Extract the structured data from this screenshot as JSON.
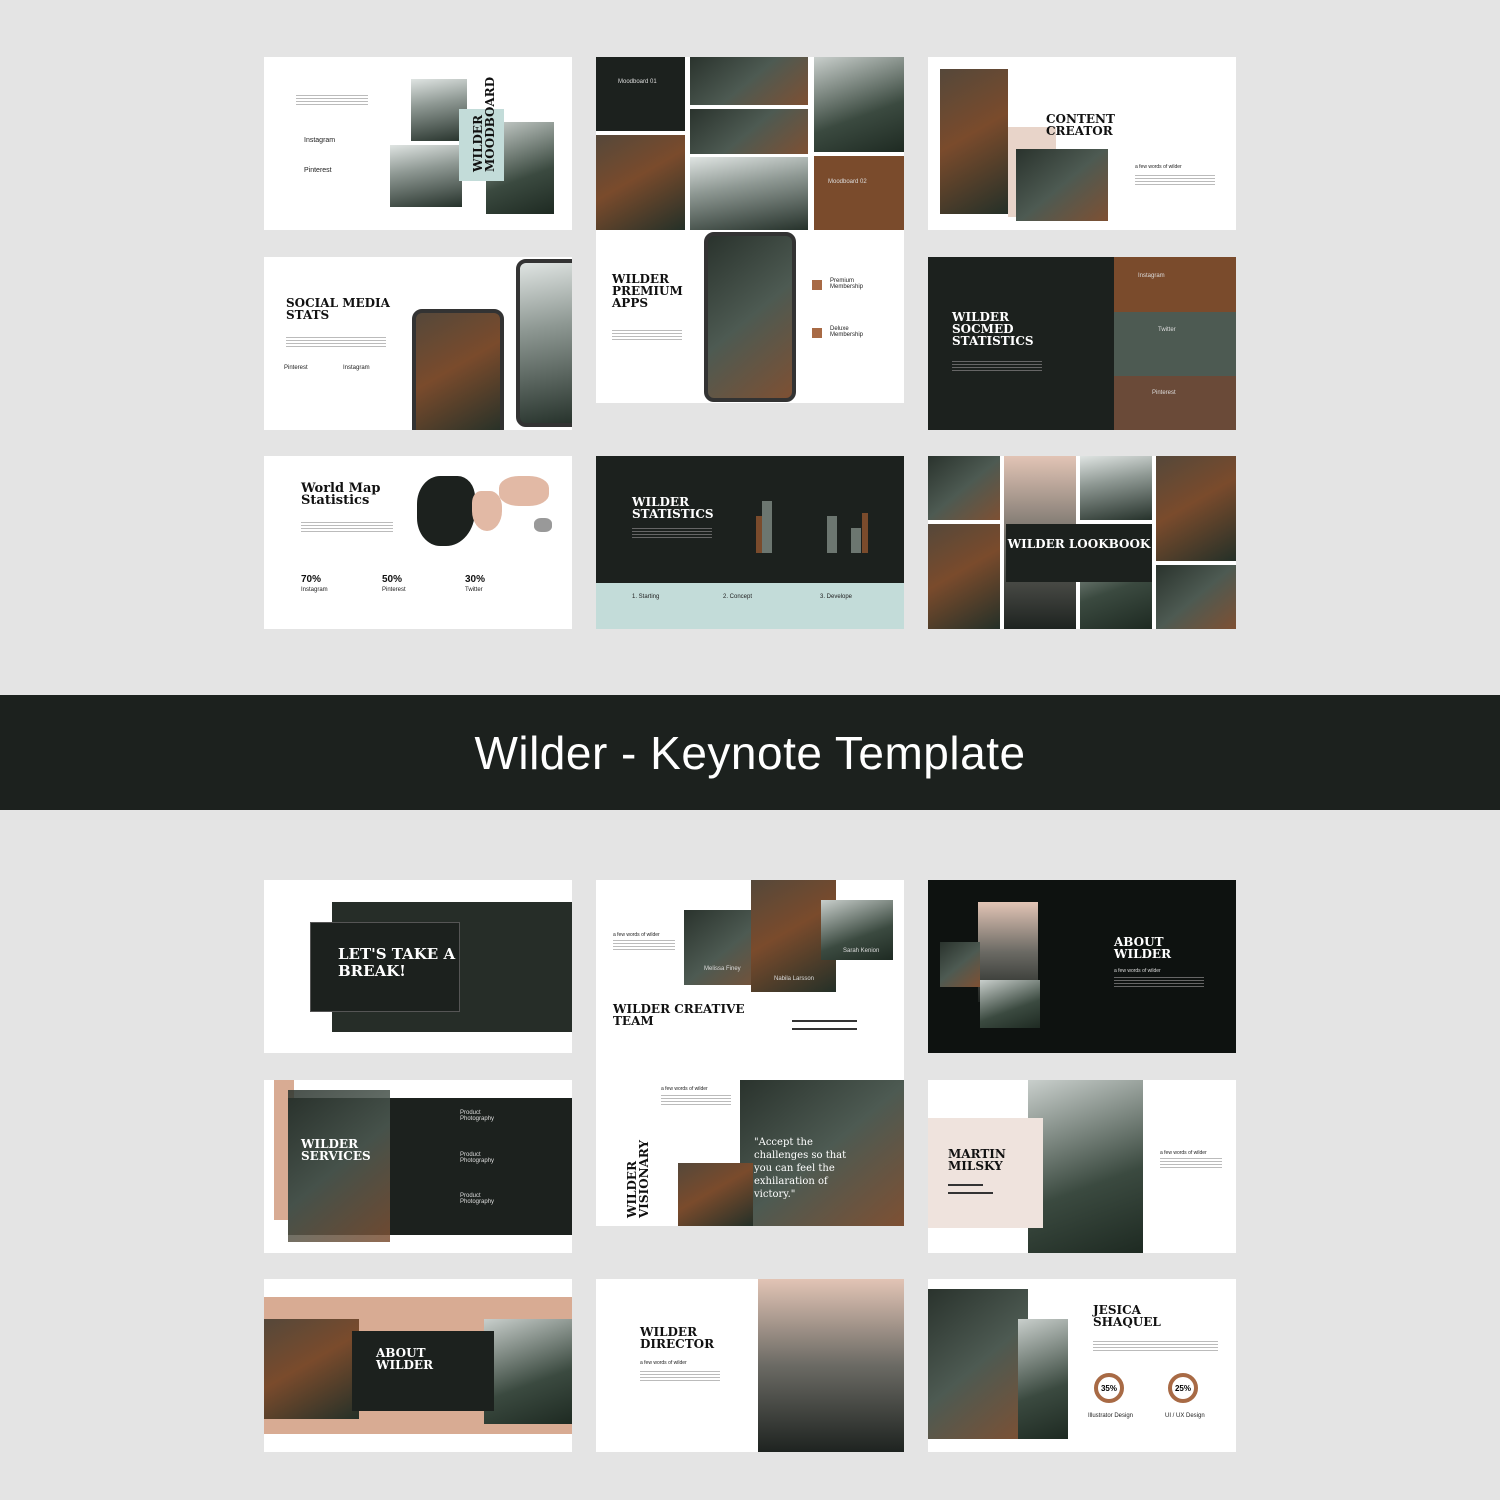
{
  "banner": {
    "title": "Wilder - Keynote Template"
  },
  "colors": {
    "dark": "#1c211e",
    "rust": "#7a4b2c",
    "mint": "#c3dcd9",
    "blush": "#e8d4c9",
    "background": "#e4e4e4"
  },
  "slides": {
    "moodboard": {
      "title": "WILDER MOODBOARD",
      "items": [
        "Instagram",
        "Pinterest"
      ]
    },
    "moodboard_grid": {
      "labels": [
        "Moodboard 01",
        "Moodboard 02"
      ]
    },
    "content_creator": {
      "title": "CONTENT CREATOR",
      "subtitle": "a few words of wilder"
    },
    "social_media": {
      "title": "SOCIAL MEDIA STATS",
      "items": [
        "Pinterest",
        "Instagram"
      ]
    },
    "premium_apps": {
      "title": "WILDER PREMIUM APPS",
      "items": [
        "Premium Membership",
        "Deluxe Membership"
      ]
    },
    "socmed_statistics": {
      "title": "WILDER SOCMED STATISTICS",
      "labels": [
        "Instagram",
        "Twitter",
        "Pinterest"
      ]
    },
    "world_map": {
      "title": "World Map Statistics",
      "stats": [
        {
          "value": "70%",
          "label": "Instagram"
        },
        {
          "value": "50%",
          "label": "Pinterest"
        },
        {
          "value": "30%",
          "label": "Twitter"
        }
      ]
    },
    "statistics": {
      "title": "WILDER STATISTICS",
      "steps": [
        "1. Starting",
        "2. Concept",
        "3. Develope"
      ]
    },
    "lookbook": {
      "title": "WILDER LOOKBOOK"
    },
    "break": {
      "title": "LET'S TAKE A BREAK!"
    },
    "creative_team": {
      "title": "WILDER CREATIVE TEAM",
      "subtitle": "a few words of wilder",
      "members": [
        "Melissa Finey",
        "Nabila Larsson",
        "Sarah Kenion"
      ]
    },
    "about_dark": {
      "title": "ABOUT WILDER",
      "subtitle": "a few words of wilder"
    },
    "services": {
      "title": "WILDER SERVICES",
      "items": [
        "Product Photography",
        "Product Photography",
        "Product Photography"
      ]
    },
    "visionary": {
      "title": "WILDER VISIONARY",
      "subtitle": "a few words of wilder",
      "quote": "\"Accept the challenges so that you can feel the exhilaration of victory.\""
    },
    "martin": {
      "title": "MARTIN MILSKY",
      "subtitle": "a few words of wilder"
    },
    "about_blush": {
      "title": "ABOUT WILDER"
    },
    "director": {
      "title": "WILDER DIRECTOR",
      "subtitle": "a few words of wilder"
    },
    "jesica": {
      "title": "JESICA SHAQUEL",
      "rings": [
        {
          "value": "35%",
          "label": "Illustrator Design"
        },
        {
          "value": "25%",
          "label": "UI / UX Design"
        }
      ]
    }
  }
}
